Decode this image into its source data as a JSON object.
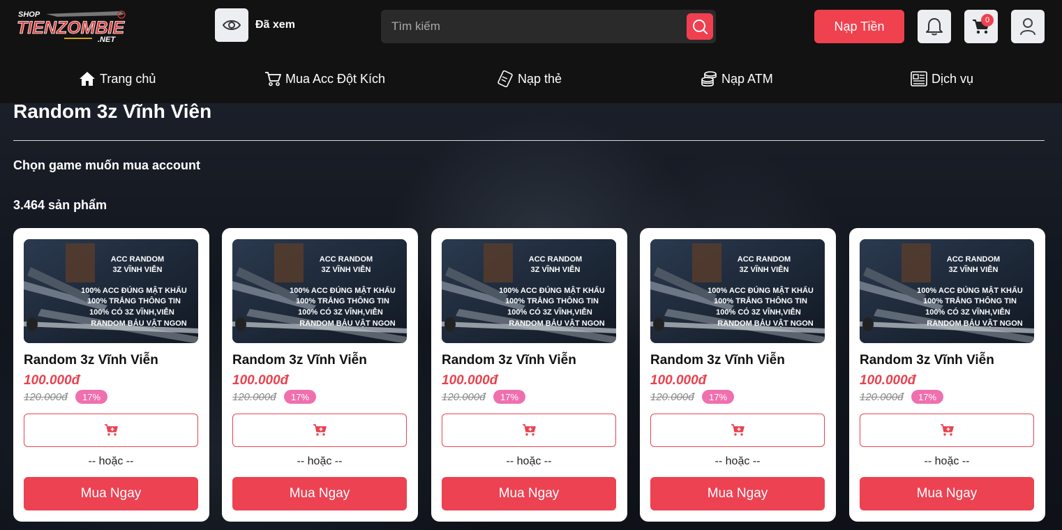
{
  "header": {
    "logo_top": "SHOP",
    "logo_main": "TIENZOMBIE",
    "logo_sub": ".NET",
    "seen_label": "Đã xem",
    "search_placeholder": "Tìm kiếm",
    "topup_label": "Nạp Tiền",
    "cart_count": "0"
  },
  "nav": {
    "items": [
      {
        "label": "Trang chủ",
        "icon": "home-icon"
      },
      {
        "label": "Mua Acc Đột Kích",
        "icon": "cart-icon"
      },
      {
        "label": "Nạp thẻ",
        "icon": "card-icon"
      },
      {
        "label": "Nạp ATM",
        "icon": "coins-icon"
      },
      {
        "label": "Dịch vụ",
        "icon": "news-icon"
      }
    ]
  },
  "page": {
    "title": "Random 3z Vĩnh Viên",
    "choose_label": "Chọn game muốn mua account",
    "count_label": "3.464 sản phẩm"
  },
  "thumb_text": {
    "line1": "ACC RANDOM",
    "line2": "3Z VĨNH VIỄN",
    "line3": "100% ACC ĐÚNG MẬT KHẨU",
    "line4": "100% TRẮNG THÔNG TIN",
    "line5": "100% CÓ 3Z VĨNH,VIỄN",
    "line6": "RANDOM BẢU VẬT NGON"
  },
  "products": [
    {
      "title": "Random 3z Vĩnh Viễn",
      "price": "100.000đ",
      "old_price": "120.000đ",
      "discount": "17%",
      "or_label": "-- hoặc --",
      "buy_label": "Mua Ngay"
    },
    {
      "title": "Random 3z Vĩnh Viễn",
      "price": "100.000đ",
      "old_price": "120.000đ",
      "discount": "17%",
      "or_label": "-- hoặc --",
      "buy_label": "Mua Ngay"
    },
    {
      "title": "Random 3z Vĩnh Viễn",
      "price": "100.000đ",
      "old_price": "120.000đ",
      "discount": "17%",
      "or_label": "-- hoặc --",
      "buy_label": "Mua Ngay"
    },
    {
      "title": "Random 3z Vĩnh Viễn",
      "price": "100.000đ",
      "old_price": "120.000đ",
      "discount": "17%",
      "or_label": "-- hoặc --",
      "buy_label": "Mua Ngay"
    },
    {
      "title": "Random 3z Vĩnh Viễn",
      "price": "100.000đ",
      "old_price": "120.000đ",
      "discount": "17%",
      "or_label": "-- hoặc --",
      "buy_label": "Mua Ngay"
    }
  ],
  "colors": {
    "accent": "#ec4252",
    "discount_badge": "#f06fae",
    "header_bg": "#121212"
  }
}
